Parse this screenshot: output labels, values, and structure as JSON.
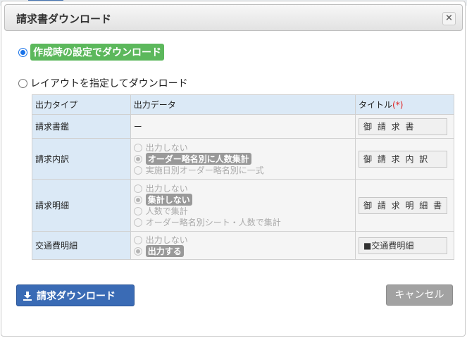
{
  "dialog": {
    "title": "請求書ダウンロード",
    "close_glyph": "×"
  },
  "options": {
    "opt1_label": "作成時の設定でダウンロード",
    "opt2_label": "レイアウトを指定してダウンロード"
  },
  "table": {
    "headers": {
      "type": "出力タイプ",
      "data": "出力データ",
      "title": "タイトル",
      "required": "(*)"
    },
    "rows": [
      {
        "label": "請求書鑑",
        "data_text": "ー",
        "title_value": "御 請 求 書"
      },
      {
        "label": "請求内訳",
        "options": [
          "出力しない",
          "オーダー略名別に人数集計",
          "実施日別オーダー略名別に一式"
        ],
        "title_value": "御 請 求 内 訳"
      },
      {
        "label": "請求明細",
        "options": [
          "出力しない",
          "集計しない",
          "人数で集計",
          "オーダー略名別シート・人数で集計"
        ],
        "title_value": "御 請 求 明 細 書"
      },
      {
        "label": "交通費明細",
        "options": [
          "出力しない",
          "出力する"
        ],
        "title_value": "■交通費明細"
      }
    ]
  },
  "buttons": {
    "download_label": "請求ダウンロード",
    "cancel_label": "キャンセル"
  },
  "colors": {
    "accent_green": "#5cb85c",
    "primary_blue": "#3a6bb5",
    "header_blue": "#dbe9f6",
    "required_red": "#e02020"
  }
}
